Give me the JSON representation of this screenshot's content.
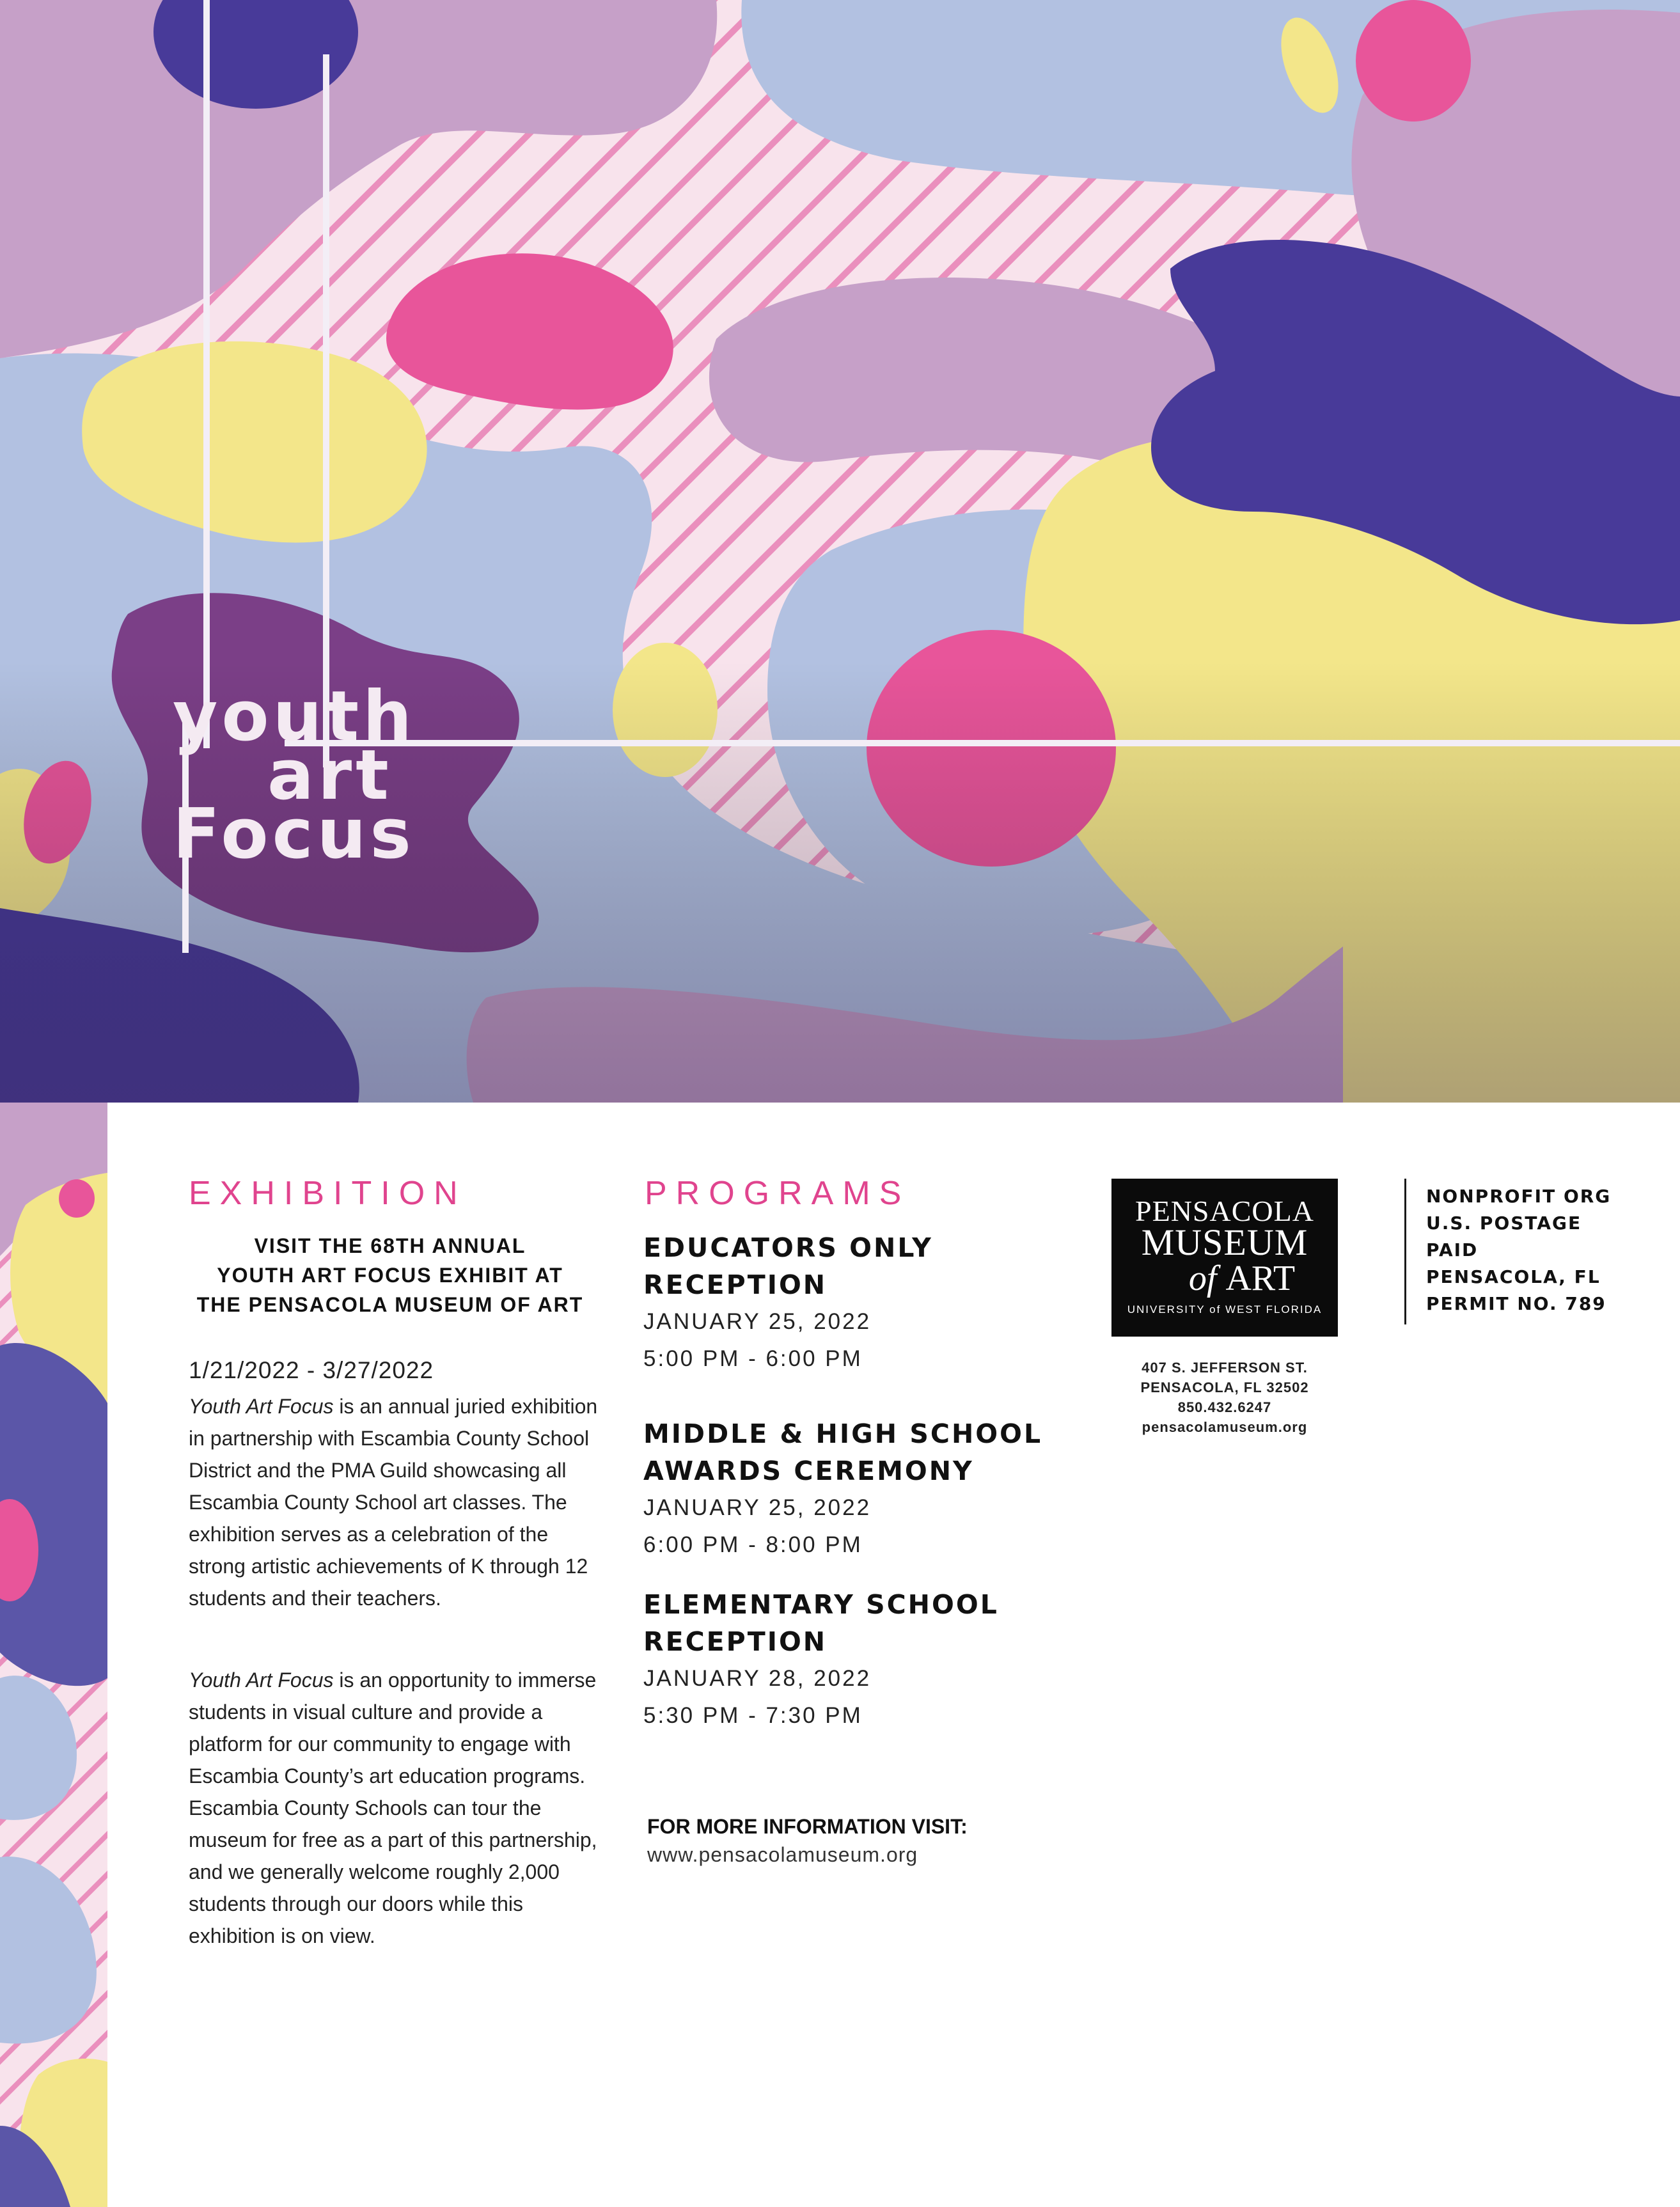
{
  "logo": {
    "line1": "youth",
    "line2": "art",
    "line3": "Focus"
  },
  "exhibition": {
    "heading": "EXHIBITION",
    "intro": [
      "VISIT THE 68TH ANNUAL",
      "YOUTH ART FOCUS EXHIBIT AT",
      "THE PENSACOLA MUSEUM OF ART"
    ],
    "dates": "1/21/2022 - 3/27/2022",
    "p1_italic": "Youth Art Focus",
    "p1_rest": " is an annual juried exhibition in partnership with Escambia County School District and the PMA Guild showcasing all Escambia County School art classes. The exhibition serves as a celebration of the strong artistic achievements of K through 12 students and their teachers.",
    "p2_italic": "Youth Art Focus",
    "p2_rest": " is an opportunity to immerse students in visual culture and provide a platform for our community to engage with Escambia County’s art education programs. Escambia County Schools can tour the museum for free as a part of this partnership, and we generally welcome roughly 2,000 students through our doors while this exhibition is on view."
  },
  "programs": {
    "heading": "PROGRAMS",
    "items": [
      {
        "title1": "EDUCATORS ONLY",
        "title2": "RECEPTION",
        "date": "JANUARY 25, 2022",
        "time": "5:00 PM - 6:00 PM"
      },
      {
        "title1": "MIDDLE & HIGH SCHOOL",
        "title2": "AWARDS CEREMONY",
        "date": "JANUARY 25, 2022",
        "time": "6:00 PM - 8:00 PM"
      },
      {
        "title1": "ELEMENTARY SCHOOL",
        "title2": "RECEPTION",
        "date": "JANUARY 28, 2022",
        "time": "5:30 PM - 7:30 PM"
      }
    ],
    "more_info_label": "FOR MORE INFORMATION VISIT:",
    "more_info_url": "www.pensacolamuseum.org"
  },
  "museum": {
    "line1": "PENSACOLA",
    "line2": "MUSEUM",
    "line3_of": "of",
    "line3_art": "ART",
    "tagline": "UNIVERSITY of WEST FLORIDA",
    "address": [
      "407 S. JEFFERSON ST.",
      "PENSACOLA, FL 32502",
      "850.432.6247",
      "pensacolamuseum.org"
    ]
  },
  "postage": [
    "NONPROFIT ORG",
    "U.S. POSTAGE",
    "PAID",
    "PENSACOLA, FL",
    "PERMIT NO. 789"
  ],
  "colors": {
    "pink": "#e8559a",
    "lavender": "#c6a0c8",
    "periwinkle": "#b2c1e1",
    "yellow": "#f3e68a",
    "indigo": "#483a99",
    "plum": "#7b3f87",
    "stripe_bg": "#f6dde8"
  }
}
